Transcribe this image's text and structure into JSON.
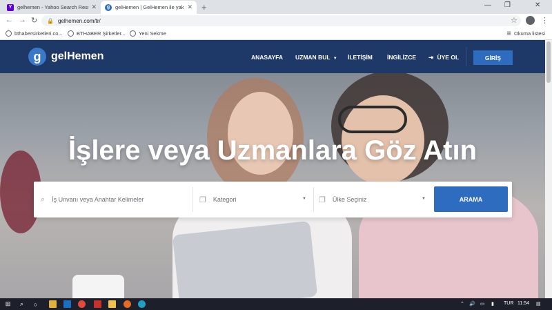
{
  "browser": {
    "tabs": [
      {
        "title": "gelhemen - Yahoo Search Results",
        "favicon_color": "#5f01d1",
        "favicon_letter": "Y"
      },
      {
        "title": "gelHemen | GelHemen ile yakını",
        "favicon_color": "#2e6cc0",
        "favicon_letter": "g"
      }
    ],
    "url": "gelhemen.com/tr/",
    "bookmarks": [
      "bthabersirketleri.co...",
      "BTHABER Şirketler...",
      "Yeni Sekme"
    ],
    "reading_list": "Okuma listesi"
  },
  "site": {
    "logo_letter": "g",
    "logo_text": "gelHemen",
    "nav": {
      "home": "ANASAYFA",
      "find_expert": "UZMAN BUL",
      "contact": "İLETİŞİM",
      "english": "İNGİLİZCE",
      "signup": "ÜYE OL",
      "login": "GİRİŞ"
    },
    "headline": "İşlere veya Uzmanlara Göz Atın",
    "search": {
      "keyword_placeholder": "İş Unvanı veya Anahtar Kelimeler",
      "category_label": "Kategori",
      "country_label": "Ülke Seçiniz",
      "button": "ARAMA"
    },
    "accent_color": "#2e6cc0",
    "nav_bg_color": "#1e3867"
  },
  "taskbar": {
    "language": "TUR",
    "time": "11:54"
  }
}
